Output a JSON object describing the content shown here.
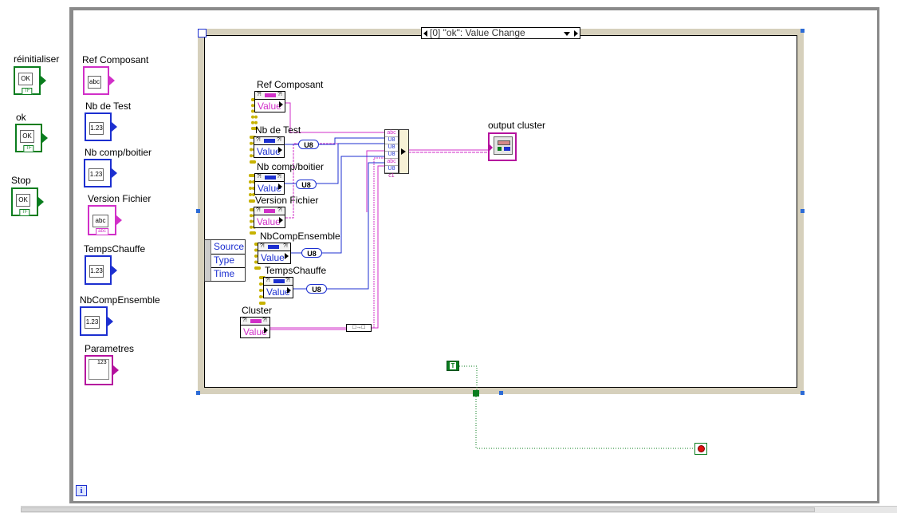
{
  "controls": {
    "reinitialiser": {
      "label": "réinitialiser",
      "text": "OK",
      "tag": "TF"
    },
    "ok": {
      "label": "ok",
      "text": "OK",
      "tag": "TF"
    },
    "stop": {
      "label": "Stop",
      "text": "OK",
      "tag": "TF"
    },
    "ref_composant": {
      "label": "Ref Composant",
      "text": "abc"
    },
    "nb_de_test": {
      "label": "Nb de Test",
      "text": "1.23"
    },
    "nb_comp_boitier": {
      "label": "Nb comp/boitier",
      "text": "1.23"
    },
    "version_fichier": {
      "label": "Version Fichier",
      "text": "abc",
      "tag": "abc"
    },
    "temps_chauffe": {
      "label": "TempsChauffe",
      "text": "1.23"
    },
    "nb_comp_ensemble": {
      "label": "NbCompEnsemble",
      "text": "1.23"
    },
    "parametres": {
      "label": "Parametres",
      "text": "123"
    }
  },
  "event_structure": {
    "selector": "[0] \"ok\": Value Change",
    "event_data": [
      "Source",
      "Type",
      "Time"
    ]
  },
  "property_nodes": [
    {
      "label": "Ref Composant",
      "value": "Value"
    },
    {
      "label": "Nb de Test",
      "value": "Value"
    },
    {
      "label": "Nb comp/boitier",
      "value": "Value"
    },
    {
      "label": "Version Fichier",
      "value": "Value"
    },
    {
      "label": "NbCompEnsemble",
      "value": "Value"
    },
    {
      "label": "TempsChauffe",
      "value": "Value"
    },
    {
      "label": "Cluster",
      "value": "Value"
    }
  ],
  "conversions": [
    "U8",
    "U8",
    "U8",
    "U8"
  ],
  "bundle_rows": [
    "abc",
    "U8",
    "U8",
    "U8",
    "abc",
    "U8",
    "U8",
    "c1"
  ],
  "indicator": {
    "label": "output cluster"
  },
  "constant": {
    "text": "T"
  },
  "info_icon": "i",
  "colors": {
    "boolean": "#0a7d1e",
    "string": "#d12fc8",
    "numeric": "#1c2fd0",
    "cluster": "#b5119e"
  }
}
